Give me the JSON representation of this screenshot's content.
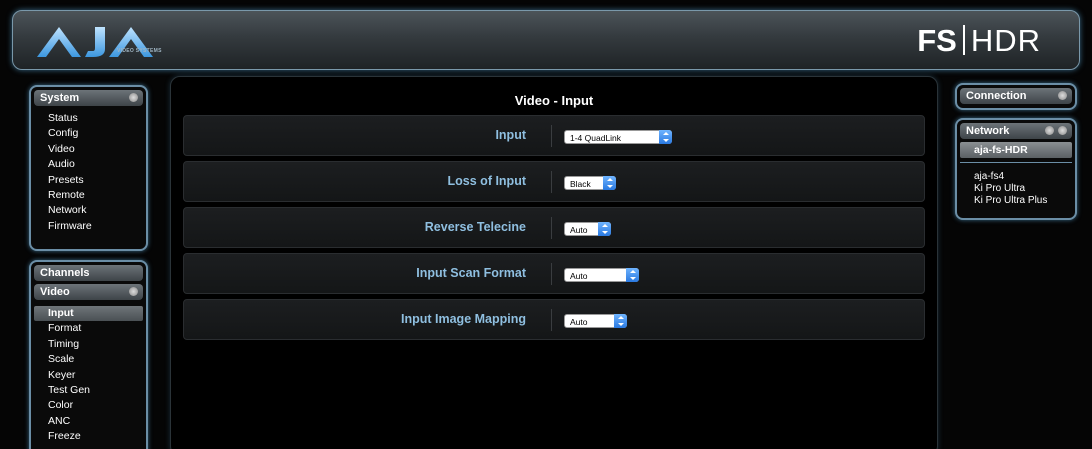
{
  "header": {
    "logo_text": "AJA",
    "logo_subtitle": "VIDEO SYSTEMS",
    "product_fs": "FS",
    "product_hdr": "HDR"
  },
  "system_panel": {
    "title": "System",
    "items": [
      "Status",
      "Config",
      "Video",
      "Audio",
      "Presets",
      "Remote",
      "Network",
      "Firmware"
    ]
  },
  "channels_panel": {
    "title": "Channels",
    "video_title": "Video",
    "items": [
      "Input",
      "Format",
      "Timing",
      "Scale",
      "Keyer",
      "Test Gen",
      "Color",
      "ANC",
      "Freeze"
    ],
    "active_item": "Input"
  },
  "main": {
    "title": "Video - Input",
    "rows": [
      {
        "label": "Input",
        "value": "1-4 QuadLink"
      },
      {
        "label": "Loss of Input",
        "value": "Black"
      },
      {
        "label": "Reverse Telecine",
        "value": "Auto"
      },
      {
        "label": "Input Scan Format",
        "value": "Auto"
      },
      {
        "label": "Input Image Mapping",
        "value": "Auto"
      }
    ]
  },
  "connection_panel": {
    "title": "Connection"
  },
  "network_panel": {
    "title": "Network",
    "selected": "aja-fs-HDR",
    "devices": [
      "aja-fs4",
      "Ki Pro Ultra",
      "Ki Pro Ultra Plus"
    ]
  },
  "colors": {
    "accent_blue": "#8fbfe0",
    "panel_border": "#6b8ea6",
    "select_arrow": "#2a79e0"
  }
}
